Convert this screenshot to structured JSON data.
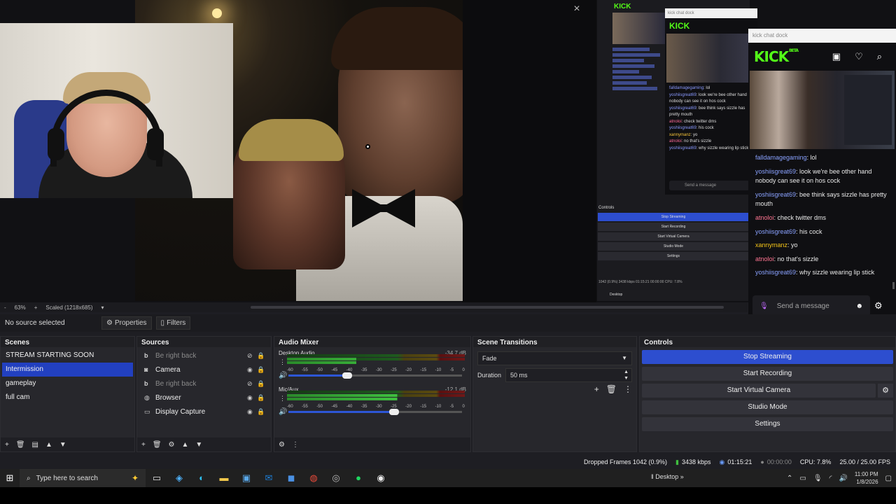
{
  "preview": {
    "close_glyph": "×",
    "zoom_percent": "63%",
    "scale_label": "Scaled (1218x685)",
    "zoom_minus": "-",
    "zoom_plus": "+"
  },
  "mini_obs": {
    "kick_logo": "KICK",
    "controls_title": "Controls",
    "buttons": [
      "Stop Streaming",
      "Start Recording",
      "Start Virtual Camera",
      "Studio Mode",
      "Settings"
    ],
    "status": "1042 (0.9%)  3438 kbps  01:15:21  00:00:00  CPU: 7.8%",
    "task_label": "Desktop",
    "chat_title": "kick chat dock"
  },
  "mid_dock": {
    "title": "kick chat dock",
    "logo": "KICK",
    "messages": [
      {
        "user": "falldamagegaming",
        "text": ": lol",
        "color": "u1"
      },
      {
        "user": "yoshiisgreat69",
        "text": ": look we're bee other hand nobody can see it on hos cock",
        "color": "u1"
      },
      {
        "user": "yoshiisgreat69",
        "text": ": bee think says sizzle has pretty mouth",
        "color": "u1"
      },
      {
        "user": "atnoloi",
        "text": ": check twitter dms",
        "color": "u2"
      },
      {
        "user": "yoshiisgreat69",
        "text": ": his cock",
        "color": "u1"
      },
      {
        "user": "xannymanz",
        "text": ": yo",
        "color": "u3"
      },
      {
        "user": "atnoloi",
        "text": ": no that's sizzle",
        "color": "u2"
      },
      {
        "user": "yoshiisgreat69",
        "text": ": why sizzle wearing lip stick",
        "color": "u1"
      }
    ],
    "send_placeholder": "Send a message"
  },
  "chat_dock": {
    "title": "kick chat dock",
    "logo": "KICK",
    "beta": "BETA",
    "icons": [
      "browse-icon",
      "heart-icon",
      "search-icon"
    ],
    "messages": [
      {
        "user": "falldamagegaming",
        "text": ": lol",
        "color": "#8aa2ff"
      },
      {
        "user": "yoshiisgreat69",
        "text": ": look we're bee other hand nobody can see it on hos cock",
        "color": "#8aa2ff"
      },
      {
        "user": "yoshiisgreat69",
        "text": ": bee think says sizzle has pretty mouth",
        "color": "#8aa2ff"
      },
      {
        "user": "atnoloi",
        "text": ": check twitter dms",
        "color": "#ff7592"
      },
      {
        "user": "yoshiisgreat69",
        "text": ": his cock",
        "color": "#8aa2ff"
      },
      {
        "user": "xannymanz",
        "text": ": yo",
        "color": "#f5c518"
      },
      {
        "user": "atnoloi",
        "text": ": no that's sizzle",
        "color": "#ff7592"
      },
      {
        "user": "yoshiisgreat69",
        "text": ": why sizzle wearing lip stick",
        "color": "#8aa2ff"
      }
    ],
    "send_placeholder": "Send a message"
  },
  "source_bar": {
    "no_source": "No source selected",
    "properties": "Properties",
    "filters": "Filters"
  },
  "scenes": {
    "title": "Scenes",
    "items": [
      "STREAM STARTING SOON",
      "Intermission",
      "gameplay",
      "full cam"
    ],
    "selected_index": 1
  },
  "sources": {
    "title": "Sources",
    "items": [
      {
        "label": "Be right back",
        "icon": "text-icon",
        "visible": false
      },
      {
        "label": "Camera",
        "icon": "camera-icon",
        "visible": true
      },
      {
        "label": "Be right back",
        "icon": "text-icon",
        "visible": false
      },
      {
        "label": "Browser",
        "icon": "globe-icon",
        "visible": true
      },
      {
        "label": "Display Capture",
        "icon": "monitor-icon",
        "visible": true
      }
    ]
  },
  "mixer": {
    "title": "Audio Mixer",
    "channels": [
      {
        "name": "Desktop Audio",
        "db": "-34.7 dB",
        "volume": 0.34
      },
      {
        "name": "Mic/Aux",
        "db": "-12.1 dB",
        "volume": 0.61
      }
    ],
    "ticks": [
      "-60",
      "-55",
      "-50",
      "-45",
      "-40",
      "-35",
      "-30",
      "-25",
      "-20",
      "-15",
      "-10",
      "-5",
      "0"
    ]
  },
  "transitions": {
    "title": "Scene Transitions",
    "selected": "Fade",
    "duration_label": "Duration",
    "duration_value": "50 ms"
  },
  "controls": {
    "title": "Controls",
    "buttons": [
      "Stop Streaming",
      "Start Recording",
      "Start Virtual Camera",
      "Studio Mode",
      "Settings"
    ],
    "accent": "#2d4ecf"
  },
  "status": {
    "dropped": "Dropped Frames 1042 (0.9%)",
    "bitrate": "3438 kbps",
    "live_time": "01:15:21",
    "rec_time": "00:00:00",
    "cpu": "CPU: 7.8%",
    "fps": "25.00 / 25.00 FPS"
  },
  "taskbar": {
    "search_placeholder": "Type here to search",
    "desktop_label": "Desktop",
    "time": "11:00 PM",
    "date": "1/8/2026"
  }
}
